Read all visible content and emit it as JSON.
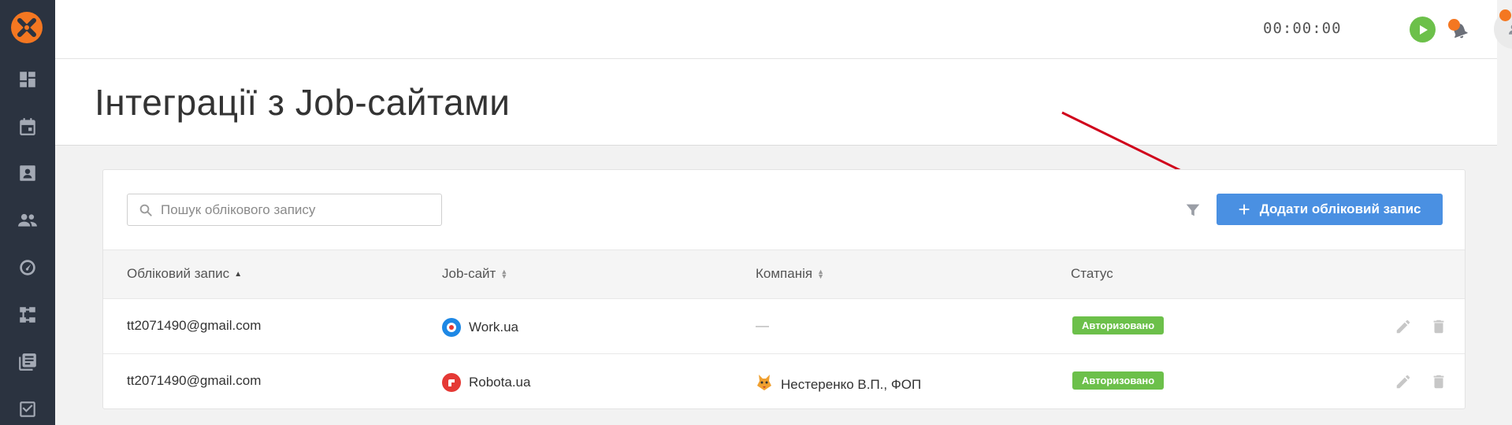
{
  "header": {
    "timer": "00:00:00"
  },
  "sidebar": {
    "items": [
      {
        "icon": "dashboard-icon"
      },
      {
        "icon": "calendar-icon"
      },
      {
        "icon": "contact-card-icon"
      },
      {
        "icon": "people-icon"
      },
      {
        "icon": "speedometer-icon"
      },
      {
        "icon": "workflow-icon"
      },
      {
        "icon": "library-icon"
      },
      {
        "icon": "checkbox-icon"
      }
    ]
  },
  "page": {
    "title": "Інтеграції з Job-сайтами"
  },
  "toolbar": {
    "search_placeholder": "Пошук облікового запису",
    "add_label": "Додати обліковий запис"
  },
  "table": {
    "columns": [
      "Обліковий запис",
      "Job-сайт",
      "Компанія",
      "Статус"
    ],
    "rows": [
      {
        "account": "tt2071490@gmail.com",
        "site": "Work.ua",
        "company": "—",
        "status": "Авторизовано"
      },
      {
        "account": "tt2071490@gmail.com",
        "site": "Robota.ua",
        "company": "Нестеренко В.П., ФОП",
        "status": "Авторизовано"
      }
    ]
  },
  "colors": {
    "sidebar_bg": "#2b3340",
    "accent_blue": "#4a90e2",
    "status_green": "#6cc04a",
    "brand_orange": "#f47721",
    "arrow_red": "#d0021b"
  }
}
